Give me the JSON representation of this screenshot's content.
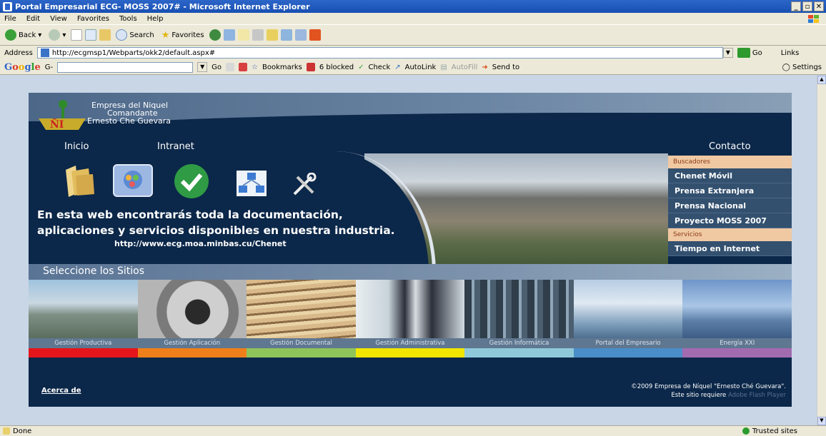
{
  "window": {
    "title": "Portal Empresarial ECG- MOSS 2007# - Microsoft Internet Explorer"
  },
  "menu": [
    "File",
    "Edit",
    "View",
    "Favorites",
    "Tools",
    "Help"
  ],
  "toolbar": {
    "back": "Back",
    "search": "Search",
    "favorites": "Favorites"
  },
  "address": {
    "label": "Address",
    "url": "http://ecgmsp1/Webparts/okk2/default.aspx#",
    "go": "Go",
    "links": "Links"
  },
  "googlebar": {
    "logo": "Google",
    "prefix": "G-",
    "go": "Go",
    "bookmarks": "Bookmarks",
    "blocked": "6 blocked",
    "check": "Check",
    "autolink": "AutoLink",
    "autofill": "AutoFill",
    "sendto": "Send to",
    "settings": "Settings"
  },
  "status": {
    "left": "Done",
    "right": "Trusted sites"
  },
  "portal": {
    "logo_line1": "Empresa del Niquel",
    "logo_line2": "Comandante",
    "logo_line3": "Ernesto Che Guevara",
    "nav": {
      "inicio": "Inicio",
      "intranet": "Intranet",
      "contacto": "Contacto"
    },
    "hero_line1": "En esta web encontrarás toda la documentación,",
    "hero_line2": "aplicaciones y servicios disponibles en nuestra industria.",
    "hero_url": "http://www.ecg.moa.minbas.cu/Chenet",
    "side_hdr1": "Buscadores",
    "side_items1": [
      "Chenet Móvil",
      "Prensa Extranjera",
      "Prensa Nacional",
      "Proyecto MOSS 2007"
    ],
    "side_hdr2": "Servicios",
    "side_items2": [
      "Tiempo en Internet"
    ],
    "select_title": "Seleccione los Sitios",
    "tiles": [
      {
        "label": "Gestión Productiva",
        "color": "#e5161b"
      },
      {
        "label": "Gestión Aplicación",
        "color": "#ef7f1a"
      },
      {
        "label": "Gestión Documental",
        "color": "#8fc45b"
      },
      {
        "label": "Gestión Administrativa",
        "color": "#f2e500"
      },
      {
        "label": "Gestión Informática",
        "color": "#8fc9d9"
      },
      {
        "label": "Portal del Empresario",
        "color": "#4a8ec9"
      },
      {
        "label": "Energía XXI",
        "color": "#a26bb0"
      }
    ],
    "about": "Acerca de",
    "copyright": "©2009 Empresa de Níquel \"Ernesto Ché Guevara\".",
    "requires": "Este sitio requiere",
    "flash": "Adobe Flash Player"
  }
}
